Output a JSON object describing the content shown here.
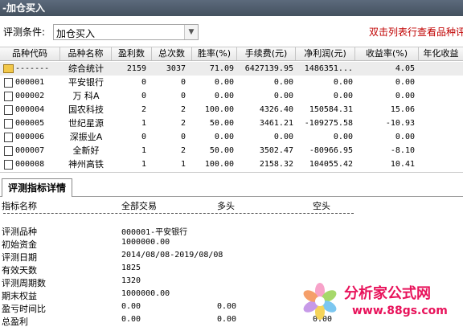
{
  "window": {
    "title": "-加仓买入"
  },
  "filter": {
    "label": "评测条件:",
    "selected": "加仓买入",
    "hint": "双击列表行查看品种评"
  },
  "table": {
    "columns": [
      "品种代码",
      "品种名称",
      "盈利数",
      "总次数",
      "胜率(%)",
      "手续费(元)",
      "净利润(元)",
      "收益率(%)",
      "年化收益"
    ],
    "rows": [
      {
        "code": "-------",
        "name": "综合统计",
        "wins": "2159",
        "total": "3037",
        "winrate": "71.09",
        "fee": "6427139.95",
        "profit": "1486351...",
        "return": "4.05",
        "annual": ""
      },
      {
        "code": "000001",
        "name": "平安银行",
        "wins": "0",
        "total": "0",
        "winrate": "0.00",
        "fee": "0.00",
        "profit": "0.00",
        "return": "0.00",
        "annual": ""
      },
      {
        "code": "000002",
        "name": "万 科A",
        "wins": "0",
        "total": "0",
        "winrate": "0.00",
        "fee": "0.00",
        "profit": "0.00",
        "return": "0.00",
        "annual": ""
      },
      {
        "code": "000004",
        "name": "国农科技",
        "wins": "2",
        "total": "2",
        "winrate": "100.00",
        "fee": "4326.40",
        "profit": "150584.31",
        "return": "15.06",
        "annual": ""
      },
      {
        "code": "000005",
        "name": "世纪星源",
        "wins": "1",
        "total": "2",
        "winrate": "50.00",
        "fee": "3461.21",
        "profit": "-109275.58",
        "return": "-10.93",
        "annual": ""
      },
      {
        "code": "000006",
        "name": "深振业A",
        "wins": "0",
        "total": "0",
        "winrate": "0.00",
        "fee": "0.00",
        "profit": "0.00",
        "return": "0.00",
        "annual": ""
      },
      {
        "code": "000007",
        "name": "全新好",
        "wins": "1",
        "total": "2",
        "winrate": "50.00",
        "fee": "3502.47",
        "profit": "-80966.95",
        "return": "-8.10",
        "annual": ""
      },
      {
        "code": "000008",
        "name": "神州高铁",
        "wins": "1",
        "total": "1",
        "winrate": "100.00",
        "fee": "2158.32",
        "profit": "104055.42",
        "return": "10.41",
        "annual": ""
      }
    ]
  },
  "tab": {
    "label": "评测指标详情"
  },
  "detail": {
    "headers": [
      "指标名称",
      "全部交易",
      "多头",
      "空头"
    ],
    "lines": [
      {
        "label": "评测品种",
        "v1": "000001-平安银行",
        "v2": "",
        "v3": ""
      },
      {
        "label": "初始资金",
        "v1": "1000000.00",
        "v2": "",
        "v3": ""
      },
      {
        "label": "评测日期",
        "v1": "2014/08/08-2019/08/08",
        "v2": "",
        "v3": ""
      },
      {
        "label": "有效天数",
        "v1": "1825",
        "v2": "",
        "v3": ""
      },
      {
        "label": "评测周期数",
        "v1": "1320",
        "v2": "",
        "v3": ""
      },
      {
        "label": "期末权益",
        "v1": "1000000.00",
        "v2": "",
        "v3": ""
      },
      {
        "label": "盈亏时间比",
        "v1": "0.00",
        "v2": "0.00",
        "v3": ""
      },
      {
        "label": "总盈利",
        "v1": "0.00",
        "v2": "0.00",
        "v3": "0.00"
      }
    ]
  },
  "watermark": {
    "title": "分析家公式网",
    "url": "www.88gs.com"
  },
  "colors": {
    "accent_red": "#c00000",
    "watermark_pink": "#e8135b",
    "title_bar": "#4d5a69"
  },
  "icons": {
    "summary_row": "folder-icon",
    "stock_row": "document-icon",
    "dropdown": "chevron-down-icon"
  }
}
